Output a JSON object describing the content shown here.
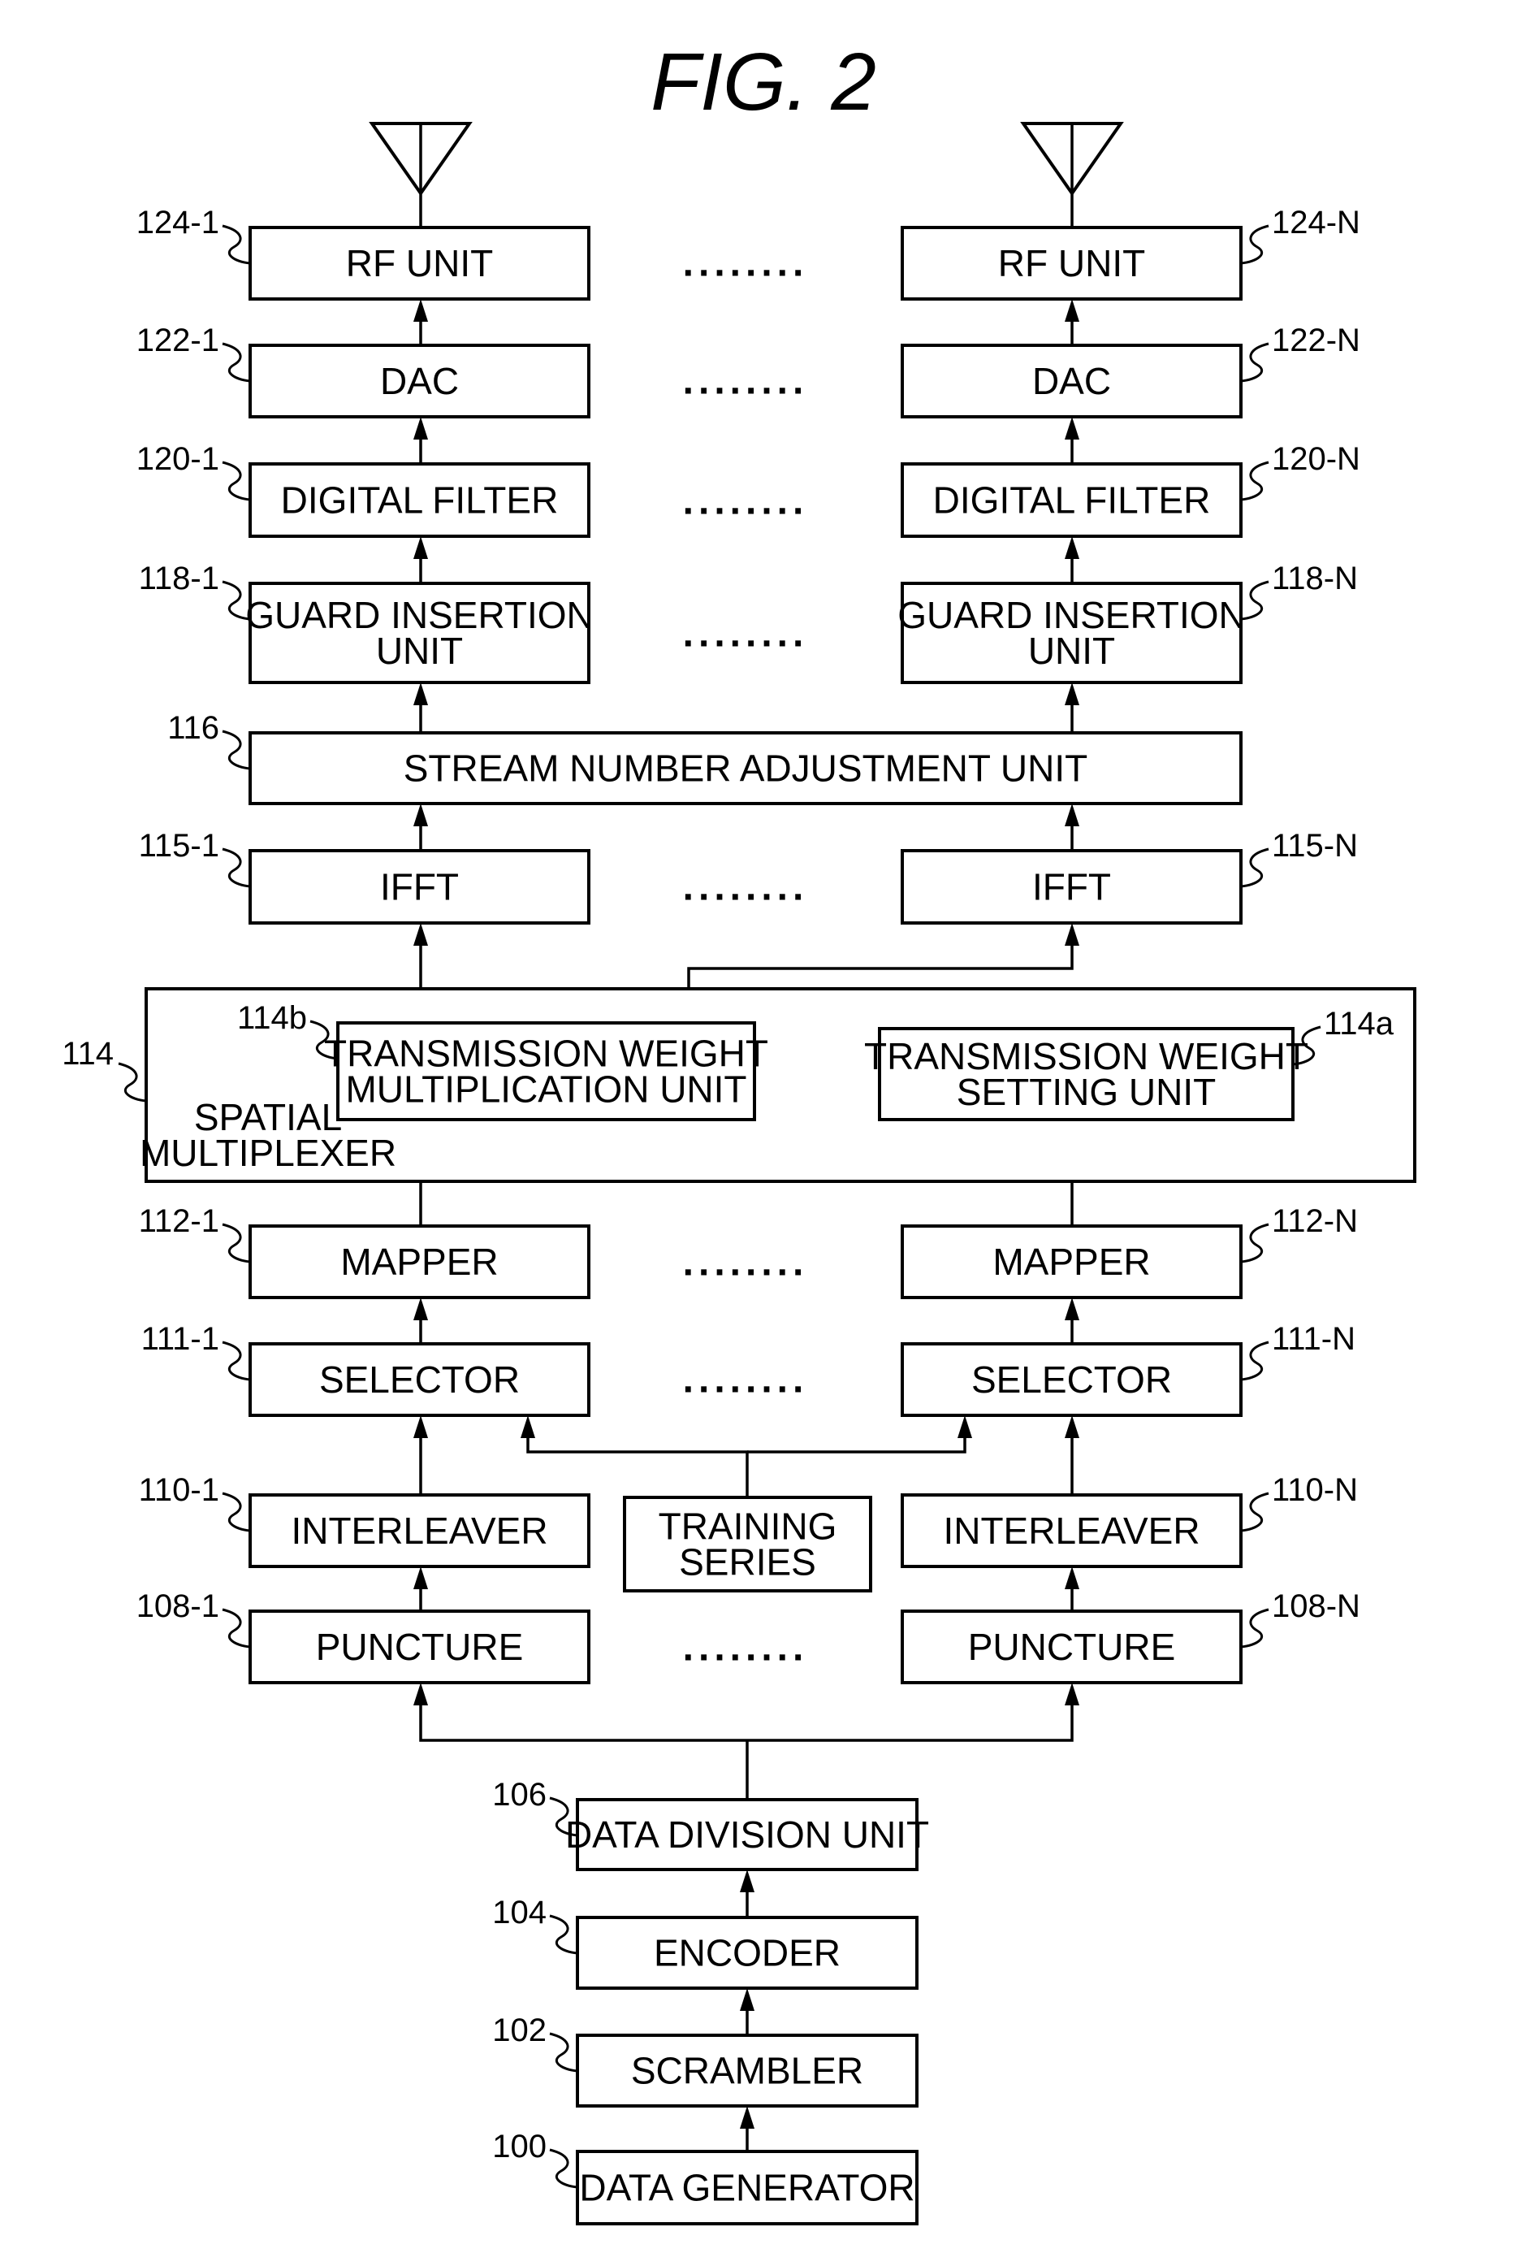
{
  "figure": {
    "title": "FIG. 2",
    "ellipsis": "........",
    "blocks": {
      "rf_unit_1": {
        "ref": "124-1",
        "lines": [
          "RF UNIT"
        ]
      },
      "rf_unit_n": {
        "ref": "124-N",
        "lines": [
          "RF UNIT"
        ]
      },
      "dac_1": {
        "ref": "122-1",
        "lines": [
          "DAC"
        ]
      },
      "dac_n": {
        "ref": "122-N",
        "lines": [
          "DAC"
        ]
      },
      "digital_filter_1": {
        "ref": "120-1",
        "lines": [
          "DIGITAL FILTER"
        ]
      },
      "digital_filter_n": {
        "ref": "120-N",
        "lines": [
          "DIGITAL FILTER"
        ]
      },
      "guard_insertion_1": {
        "ref": "118-1",
        "lines": [
          "GUARD INSERTION",
          "UNIT"
        ]
      },
      "guard_insertion_n": {
        "ref": "118-N",
        "lines": [
          "GUARD INSERTION",
          "UNIT"
        ]
      },
      "stream_number_adjustment": {
        "ref": "116",
        "lines": [
          "STREAM NUMBER ADJUSTMENT UNIT"
        ]
      },
      "ifft_1": {
        "ref": "115-1",
        "lines": [
          "IFFT"
        ]
      },
      "ifft_n": {
        "ref": "115-N",
        "lines": [
          "IFFT"
        ]
      },
      "spatial_multiplexer": {
        "ref": "114",
        "lines": [
          "SPATIAL",
          "MULTIPLEXER"
        ]
      },
      "tx_weight_multiplication": {
        "ref": "114b",
        "lines": [
          "TRANSMISSION WEIGHT",
          "MULTIPLICATION UNIT"
        ]
      },
      "tx_weight_setting": {
        "ref": "114a",
        "lines": [
          "TRANSMISSION WEIGHT",
          "SETTING UNIT"
        ]
      },
      "mapper_1": {
        "ref": "112-1",
        "lines": [
          "MAPPER"
        ]
      },
      "mapper_n": {
        "ref": "112-N",
        "lines": [
          "MAPPER"
        ]
      },
      "selector_1": {
        "ref": "111-1",
        "lines": [
          "SELECTOR"
        ]
      },
      "selector_n": {
        "ref": "111-N",
        "lines": [
          "SELECTOR"
        ]
      },
      "interleaver_1": {
        "ref": "110-1",
        "lines": [
          "INTERLEAVER"
        ]
      },
      "interleaver_n": {
        "ref": "110-N",
        "lines": [
          "INTERLEAVER"
        ]
      },
      "training_series": {
        "ref": "",
        "lines": [
          "TRAINING",
          "SERIES"
        ]
      },
      "puncture_1": {
        "ref": "108-1",
        "lines": [
          "PUNCTURE"
        ]
      },
      "puncture_n": {
        "ref": "108-N",
        "lines": [
          "PUNCTURE"
        ]
      },
      "data_division": {
        "ref": "106",
        "lines": [
          "DATA DIVISION UNIT"
        ]
      },
      "encoder": {
        "ref": "104",
        "lines": [
          "ENCODER"
        ]
      },
      "scrambler": {
        "ref": "102",
        "lines": [
          "SCRAMBLER"
        ]
      },
      "data_generator": {
        "ref": "100",
        "lines": [
          "DATA GENERATOR"
        ]
      }
    }
  }
}
